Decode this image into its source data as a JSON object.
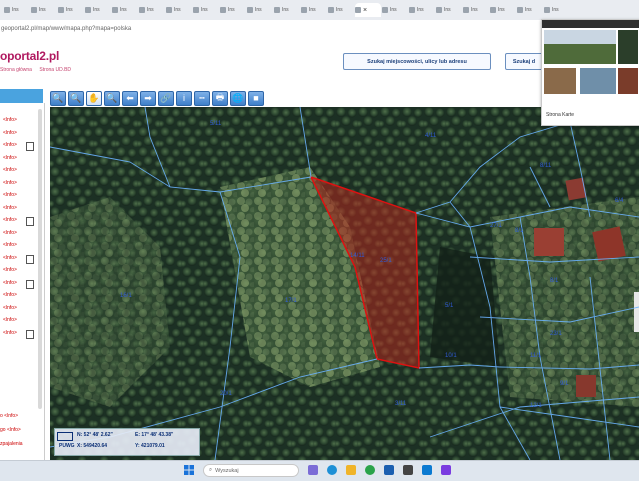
{
  "browser": {
    "tabs": [
      {
        "label": "Ins"
      },
      {
        "label": "Ins"
      },
      {
        "label": "Ins"
      },
      {
        "label": "Ins"
      },
      {
        "label": "Ins"
      },
      {
        "label": "Ins"
      },
      {
        "label": "Ins"
      },
      {
        "label": "Ins"
      },
      {
        "label": "Ins"
      },
      {
        "label": "Ins"
      },
      {
        "label": "Ins"
      },
      {
        "label": "Ins"
      },
      {
        "label": "Ins"
      },
      {
        "label": "Ins"
      },
      {
        "label": "Ins"
      },
      {
        "label": "Ins"
      },
      {
        "label": "Ins"
      },
      {
        "label": "Ins"
      },
      {
        "label": "Ins"
      },
      {
        "label": "Ins"
      },
      {
        "label": "Ins"
      }
    ],
    "active_tab_close": "×",
    "url": "geoportal2.pl/map/www/mapa.php?mapa=polska"
  },
  "site": {
    "logo": "oportal2.pl",
    "nav": [
      "Strona główna",
      "Strona UD.BD"
    ],
    "search_button": "Szukaj miejscowości, ulicy lub adresu",
    "search_button2": "Szukaj d"
  },
  "left_panel": {
    "items": [
      "<lnfo>",
      "<lnfo>",
      "<lnfo>",
      "<lnfo>",
      "<lnfo>",
      "<lnfo>",
      "<lnfo>",
      "<lnfo>",
      "<lnfo>",
      "<lnfo>",
      "<lnfo>",
      "<lnfo>",
      "<lnfo>",
      "<lnfo>",
      "<lnfo>",
      "<lnfo>",
      "<lnfo>",
      "<lnfo>"
    ],
    "footer": [
      "o <lnfo>",
      "go <lnfo>",
      "zpajalenia"
    ]
  },
  "toolbar": {
    "buttons": [
      {
        "name": "zoom-in-icon",
        "glyph": "🔍"
      },
      {
        "name": "zoom-out-icon",
        "glyph": "🔍"
      },
      {
        "name": "pan-hand-icon",
        "glyph": "✋"
      },
      {
        "name": "zoom-window-icon",
        "glyph": "🔍"
      },
      {
        "name": "back-arrow-icon",
        "glyph": "⬅"
      },
      {
        "name": "forward-arrow-icon",
        "glyph": "➡"
      },
      {
        "name": "link-icon",
        "glyph": "🔗"
      },
      {
        "name": "info-icon",
        "glyph": "i"
      },
      {
        "name": "measure-icon",
        "glyph": "┅"
      },
      {
        "name": "print-icon",
        "glyph": "🖶"
      },
      {
        "name": "globe-icon",
        "glyph": "🌐"
      },
      {
        "name": "camera-icon",
        "glyph": "■"
      }
    ]
  },
  "map": {
    "parcel_labels": [
      "5/11",
      "4/11",
      "8/11",
      "14/11",
      "16/1",
      "17/1",
      "5/1",
      "8/1",
      "23/1",
      "3/11",
      "20/1",
      "6/4",
      "8/1",
      "9/1",
      "10/1",
      "11/1",
      "12/1",
      "27/1",
      "25/1"
    ],
    "highlight_color": "#b3261e",
    "coords": {
      "lat_label": "N:",
      "lat": "52° 48' 2.62\"",
      "lon_label": "E:",
      "lon": "17° 48' 43.38\"",
      "x_label": "X:",
      "x": "549420.64",
      "y_label": "Y:",
      "y": "421079.01",
      "ref": "PUWG"
    }
  },
  "popup": {
    "title": "Strona Karte"
  },
  "taskbar": {
    "search_placeholder": "Wyszukaj"
  }
}
